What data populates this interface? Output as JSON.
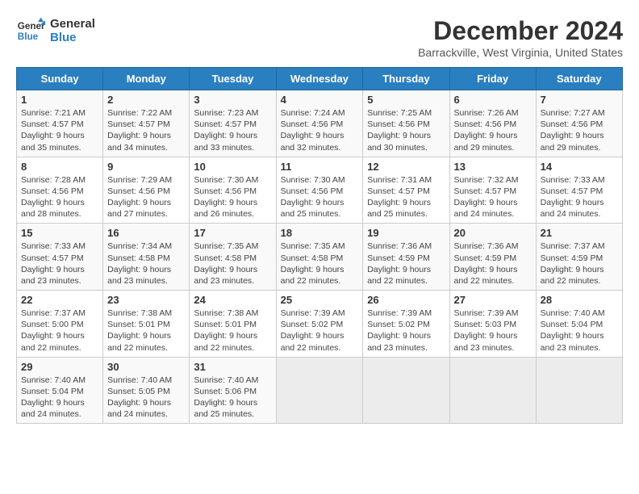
{
  "header": {
    "logo_line1": "General",
    "logo_line2": "Blue",
    "month_title": "December 2024",
    "location": "Barrackville, West Virginia, United States"
  },
  "days_of_week": [
    "Sunday",
    "Monday",
    "Tuesday",
    "Wednesday",
    "Thursday",
    "Friday",
    "Saturday"
  ],
  "weeks": [
    [
      {
        "day": "1",
        "sunrise": "7:21 AM",
        "sunset": "4:57 PM",
        "daylight": "9 hours and 35 minutes."
      },
      {
        "day": "2",
        "sunrise": "7:22 AM",
        "sunset": "4:57 PM",
        "daylight": "9 hours and 34 minutes."
      },
      {
        "day": "3",
        "sunrise": "7:23 AM",
        "sunset": "4:57 PM",
        "daylight": "9 hours and 33 minutes."
      },
      {
        "day": "4",
        "sunrise": "7:24 AM",
        "sunset": "4:56 PM",
        "daylight": "9 hours and 32 minutes."
      },
      {
        "day": "5",
        "sunrise": "7:25 AM",
        "sunset": "4:56 PM",
        "daylight": "9 hours and 30 minutes."
      },
      {
        "day": "6",
        "sunrise": "7:26 AM",
        "sunset": "4:56 PM",
        "daylight": "9 hours and 29 minutes."
      },
      {
        "day": "7",
        "sunrise": "7:27 AM",
        "sunset": "4:56 PM",
        "daylight": "9 hours and 29 minutes."
      }
    ],
    [
      {
        "day": "8",
        "sunrise": "7:28 AM",
        "sunset": "4:56 PM",
        "daylight": "9 hours and 28 minutes."
      },
      {
        "day": "9",
        "sunrise": "7:29 AM",
        "sunset": "4:56 PM",
        "daylight": "9 hours and 27 minutes."
      },
      {
        "day": "10",
        "sunrise": "7:30 AM",
        "sunset": "4:56 PM",
        "daylight": "9 hours and 26 minutes."
      },
      {
        "day": "11",
        "sunrise": "7:30 AM",
        "sunset": "4:56 PM",
        "daylight": "9 hours and 25 minutes."
      },
      {
        "day": "12",
        "sunrise": "7:31 AM",
        "sunset": "4:57 PM",
        "daylight": "9 hours and 25 minutes."
      },
      {
        "day": "13",
        "sunrise": "7:32 AM",
        "sunset": "4:57 PM",
        "daylight": "9 hours and 24 minutes."
      },
      {
        "day": "14",
        "sunrise": "7:33 AM",
        "sunset": "4:57 PM",
        "daylight": "9 hours and 24 minutes."
      }
    ],
    [
      {
        "day": "15",
        "sunrise": "7:33 AM",
        "sunset": "4:57 PM",
        "daylight": "9 hours and 23 minutes."
      },
      {
        "day": "16",
        "sunrise": "7:34 AM",
        "sunset": "4:58 PM",
        "daylight": "9 hours and 23 minutes."
      },
      {
        "day": "17",
        "sunrise": "7:35 AM",
        "sunset": "4:58 PM",
        "daylight": "9 hours and 23 minutes."
      },
      {
        "day": "18",
        "sunrise": "7:35 AM",
        "sunset": "4:58 PM",
        "daylight": "9 hours and 22 minutes."
      },
      {
        "day": "19",
        "sunrise": "7:36 AM",
        "sunset": "4:59 PM",
        "daylight": "9 hours and 22 minutes."
      },
      {
        "day": "20",
        "sunrise": "7:36 AM",
        "sunset": "4:59 PM",
        "daylight": "9 hours and 22 minutes."
      },
      {
        "day": "21",
        "sunrise": "7:37 AM",
        "sunset": "4:59 PM",
        "daylight": "9 hours and 22 minutes."
      }
    ],
    [
      {
        "day": "22",
        "sunrise": "7:37 AM",
        "sunset": "5:00 PM",
        "daylight": "9 hours and 22 minutes."
      },
      {
        "day": "23",
        "sunrise": "7:38 AM",
        "sunset": "5:01 PM",
        "daylight": "9 hours and 22 minutes."
      },
      {
        "day": "24",
        "sunrise": "7:38 AM",
        "sunset": "5:01 PM",
        "daylight": "9 hours and 22 minutes."
      },
      {
        "day": "25",
        "sunrise": "7:39 AM",
        "sunset": "5:02 PM",
        "daylight": "9 hours and 22 minutes."
      },
      {
        "day": "26",
        "sunrise": "7:39 AM",
        "sunset": "5:02 PM",
        "daylight": "9 hours and 23 minutes."
      },
      {
        "day": "27",
        "sunrise": "7:39 AM",
        "sunset": "5:03 PM",
        "daylight": "9 hours and 23 minutes."
      },
      {
        "day": "28",
        "sunrise": "7:40 AM",
        "sunset": "5:04 PM",
        "daylight": "9 hours and 23 minutes."
      }
    ],
    [
      {
        "day": "29",
        "sunrise": "7:40 AM",
        "sunset": "5:04 PM",
        "daylight": "9 hours and 24 minutes."
      },
      {
        "day": "30",
        "sunrise": "7:40 AM",
        "sunset": "5:05 PM",
        "daylight": "9 hours and 24 minutes."
      },
      {
        "day": "31",
        "sunrise": "7:40 AM",
        "sunset": "5:06 PM",
        "daylight": "9 hours and 25 minutes."
      },
      null,
      null,
      null,
      null
    ]
  ]
}
